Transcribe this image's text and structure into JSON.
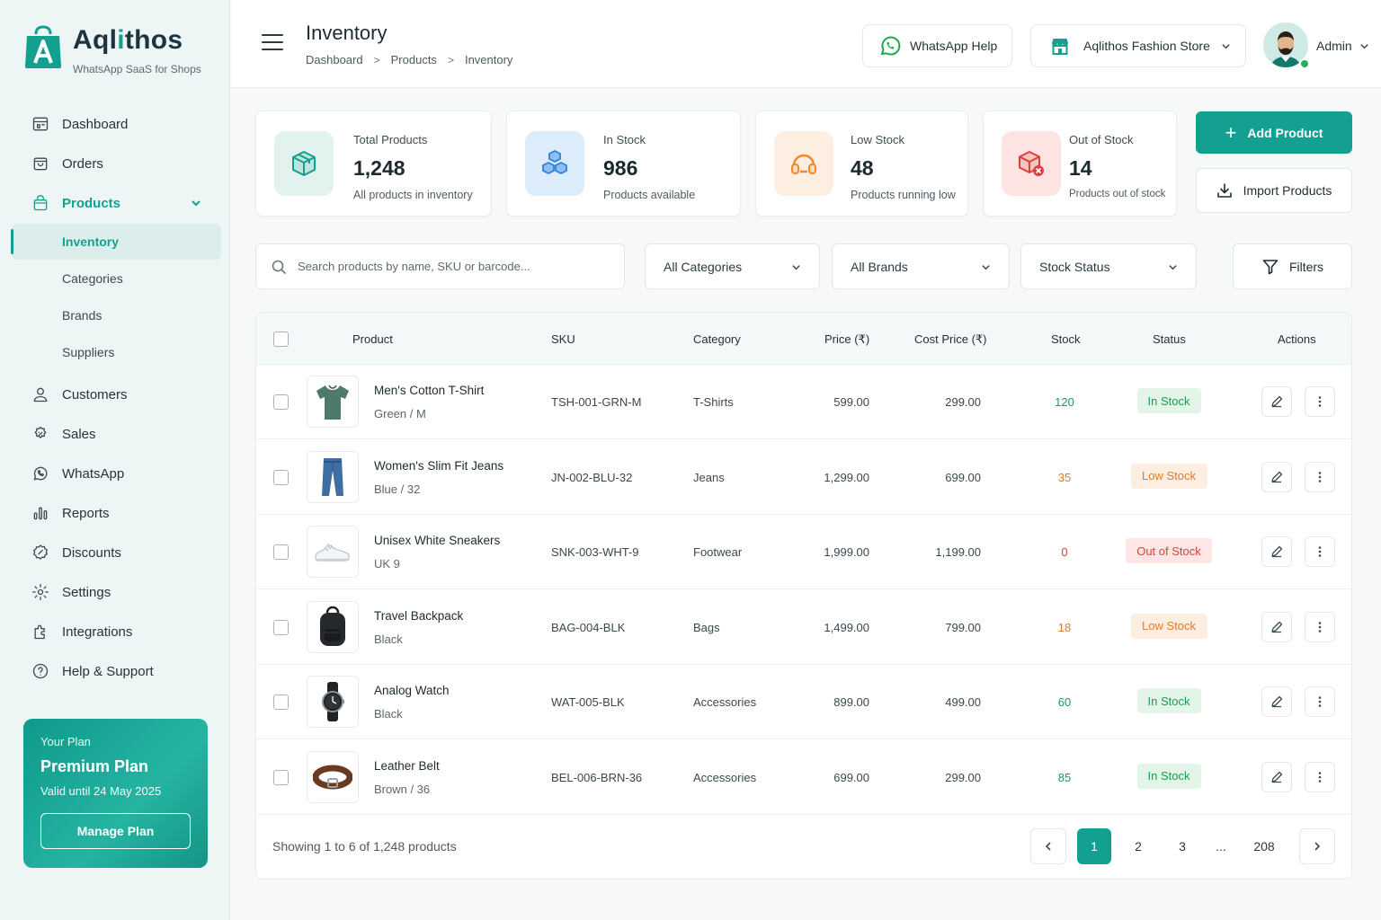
{
  "brand": {
    "name_a": "Aql",
    "name_b": "i",
    "name_c": "thos",
    "tagline": "WhatsApp SaaS for Shops"
  },
  "sidebar": {
    "items": [
      {
        "label": "Dashboard",
        "icon": "dashboard-icon"
      },
      {
        "label": "Orders",
        "icon": "bag-icon"
      },
      {
        "label": "Products",
        "icon": "products-icon"
      },
      {
        "label": "Customers",
        "icon": "user-icon"
      },
      {
        "label": "Sales",
        "icon": "sales-icon"
      },
      {
        "label": "WhatsApp",
        "icon": "whatsapp-icon"
      },
      {
        "label": "Reports",
        "icon": "reports-icon"
      },
      {
        "label": "Discounts",
        "icon": "discount-icon"
      },
      {
        "label": "Settings",
        "icon": "gear-icon"
      },
      {
        "label": "Integrations",
        "icon": "puzzle-icon"
      },
      {
        "label": "Help & Support",
        "icon": "help-icon"
      }
    ],
    "products_sub": [
      "Inventory",
      "Categories",
      "Brands",
      "Suppliers"
    ]
  },
  "plan": {
    "label": "Your Plan",
    "name": "Premium Plan",
    "valid": "Valid until 24 May 2025",
    "button": "Manage Plan"
  },
  "header": {
    "title": "Inventory",
    "breadcrumb": [
      "Dashboard",
      "Products",
      "Inventory"
    ],
    "whatsapp_help": "WhatsApp Help",
    "store": "Aqlithos Fashion Store",
    "user": "Admin"
  },
  "stats": [
    {
      "label": "Total Products",
      "value": "1,248",
      "sub": "All products in inventory"
    },
    {
      "label": "In Stock",
      "value": "986",
      "sub": "Products available"
    },
    {
      "label": "Low Stock",
      "value": "48",
      "sub": "Products running low"
    },
    {
      "label": "Out of Stock",
      "value": "14",
      "sub": "Products out of stock"
    }
  ],
  "actions": {
    "add": "Add Product",
    "import": "Import Products"
  },
  "filters": {
    "search_placeholder": "Search products by name, SKU or barcode...",
    "category": "All Categories",
    "brand": "All Brands",
    "stock": "Stock Status",
    "filters": "Filters"
  },
  "table": {
    "columns": [
      "Product",
      "SKU",
      "Category",
      "Price (₹)",
      "Cost Price (₹)",
      "Stock",
      "Status",
      "Actions"
    ],
    "rows": [
      {
        "name": "Men's Cotton T-Shirt",
        "variant": "Green / M",
        "sku": "TSH-001-GRN-M",
        "category": "T-Shirts",
        "price": "599.00",
        "cost": "299.00",
        "stock": "120",
        "status": "In Stock",
        "status_key": "in"
      },
      {
        "name": "Women's Slim Fit Jeans",
        "variant": "Blue / 32",
        "sku": "JN-002-BLU-32",
        "category": "Jeans",
        "price": "1,299.00",
        "cost": "699.00",
        "stock": "35",
        "status": "Low Stock",
        "status_key": "low"
      },
      {
        "name": "Unisex White Sneakers",
        "variant": "UK 9",
        "sku": "SNK-003-WHT-9",
        "category": "Footwear",
        "price": "1,999.00",
        "cost": "1,199.00",
        "stock": "0",
        "status": "Out of Stock",
        "status_key": "out"
      },
      {
        "name": "Travel Backpack",
        "variant": "Black",
        "sku": "BAG-004-BLK",
        "category": "Bags",
        "price": "1,499.00",
        "cost": "799.00",
        "stock": "18",
        "status": "Low Stock",
        "status_key": "low"
      },
      {
        "name": "Analog Watch",
        "variant": "Black",
        "sku": "WAT-005-BLK",
        "category": "Accessories",
        "price": "899.00",
        "cost": "499.00",
        "stock": "60",
        "status": "In Stock",
        "status_key": "in"
      },
      {
        "name": "Leather Belt",
        "variant": "Brown / 36",
        "sku": "BEL-006-BRN-36",
        "category": "Accessories",
        "price": "699.00",
        "cost": "299.00",
        "stock": "85",
        "status": "In Stock",
        "status_key": "in"
      }
    ],
    "showing": "Showing 1 to 6 of 1,248 products",
    "pages": [
      "1",
      "2",
      "3",
      "...",
      "208"
    ]
  },
  "colors": {
    "accent": "#13a091",
    "in_stock": "#1e9a52",
    "low_stock": "#e27b25",
    "out_stock": "#d9423b"
  }
}
